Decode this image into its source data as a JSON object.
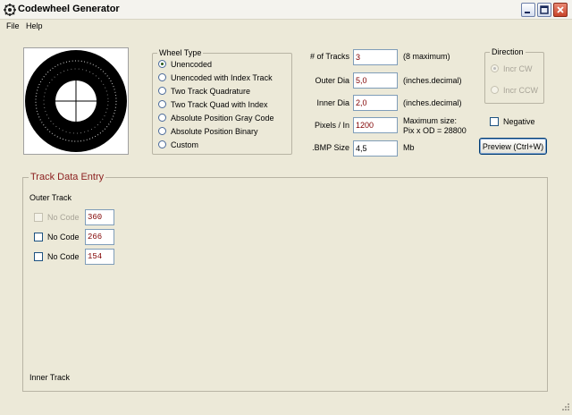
{
  "window": {
    "title": "Codewheel Generator",
    "minimize_icon": "minimize-icon",
    "maximize_icon": "maximize-icon",
    "close_icon": "close-icon"
  },
  "menu": [
    {
      "label": "File"
    },
    {
      "label": "Help"
    }
  ],
  "wheel_type": {
    "legend": "Wheel Type",
    "options": [
      {
        "label": "Unencoded",
        "selected": true
      },
      {
        "label": "Unencoded with Index Track",
        "selected": false
      },
      {
        "label": "Two Track Quadrature",
        "selected": false
      },
      {
        "label": "Two Track Quad with Index",
        "selected": false
      },
      {
        "label": "Absolute Position Gray Code",
        "selected": false
      },
      {
        "label": "Absolute Position Binary",
        "selected": false
      },
      {
        "label": "Custom",
        "selected": false
      }
    ]
  },
  "params": {
    "tracks": {
      "label": "# of Tracks",
      "value": "3",
      "note": "(8 maximum)"
    },
    "outer_dia": {
      "label": "Outer Dia",
      "value": "5,0",
      "note": "(inches.decimal)"
    },
    "inner_dia": {
      "label": "Inner Dia",
      "value": "2,0",
      "note": "(inches.decimal)"
    },
    "pixels": {
      "label": "Pixels / In",
      "value": "1200",
      "note_line1": "Maximum size:",
      "note_line2": "Pix x OD = 28800"
    },
    "bmp_size": {
      "label": ".BMP Size",
      "value": "4,5",
      "note": "Mb"
    }
  },
  "direction": {
    "legend": "Direction",
    "options": [
      {
        "label": "Incr CW",
        "selected": true
      },
      {
        "label": "Incr CCW",
        "selected": false
      }
    ]
  },
  "negative": {
    "label": "Negative",
    "checked": false
  },
  "preview_button": {
    "label": "Preview (Ctrl+W)"
  },
  "track_entry": {
    "legend": "Track Data Entry",
    "outer_label": "Outer Track",
    "inner_label": "Inner Track",
    "tracks": [
      {
        "checkbox_label": "No Code",
        "value": "360",
        "enabled": false
      },
      {
        "checkbox_label": "No Code",
        "value": "266",
        "enabled": true
      },
      {
        "checkbox_label": "No Code",
        "value": "154",
        "enabled": true
      }
    ]
  },
  "colors": {
    "accent": "#8b1e1e",
    "input_text": "#800000",
    "window_bg": "#ece9d8"
  }
}
